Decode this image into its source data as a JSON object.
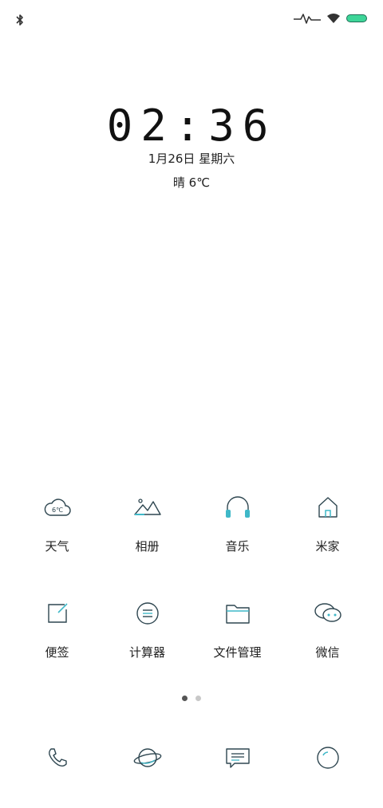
{
  "status_bar": {
    "bluetooth_icon": "bluetooth-icon",
    "signal_icon": "activity-signal-icon",
    "wifi_icon": "wifi-icon",
    "battery_icon": "battery-icon",
    "battery_color": "#3dd598"
  },
  "clock": {
    "time": "02:36",
    "date": "1月26日 星期六",
    "weather": "晴 6℃"
  },
  "apps": [
    {
      "label": "天气",
      "icon": "weather-cloud-icon",
      "icon_text": "6℃"
    },
    {
      "label": "相册",
      "icon": "gallery-mountain-icon"
    },
    {
      "label": "音乐",
      "icon": "music-headphones-icon"
    },
    {
      "label": "米家",
      "icon": "home-icon"
    },
    {
      "label": "便签",
      "icon": "notes-icon"
    },
    {
      "label": "计算器",
      "icon": "calculator-icon"
    },
    {
      "label": "文件管理",
      "icon": "folder-icon"
    },
    {
      "label": "微信",
      "icon": "wechat-icon"
    }
  ],
  "page_indicator": {
    "count": 2,
    "active_index": 0
  },
  "dock": [
    {
      "icon": "phone-icon"
    },
    {
      "icon": "browser-planet-icon"
    },
    {
      "icon": "messages-icon"
    },
    {
      "icon": "camera-icon"
    }
  ],
  "colors": {
    "icon_stroke": "#2e4650",
    "icon_accent": "#3fb8c8",
    "text": "#222222"
  }
}
